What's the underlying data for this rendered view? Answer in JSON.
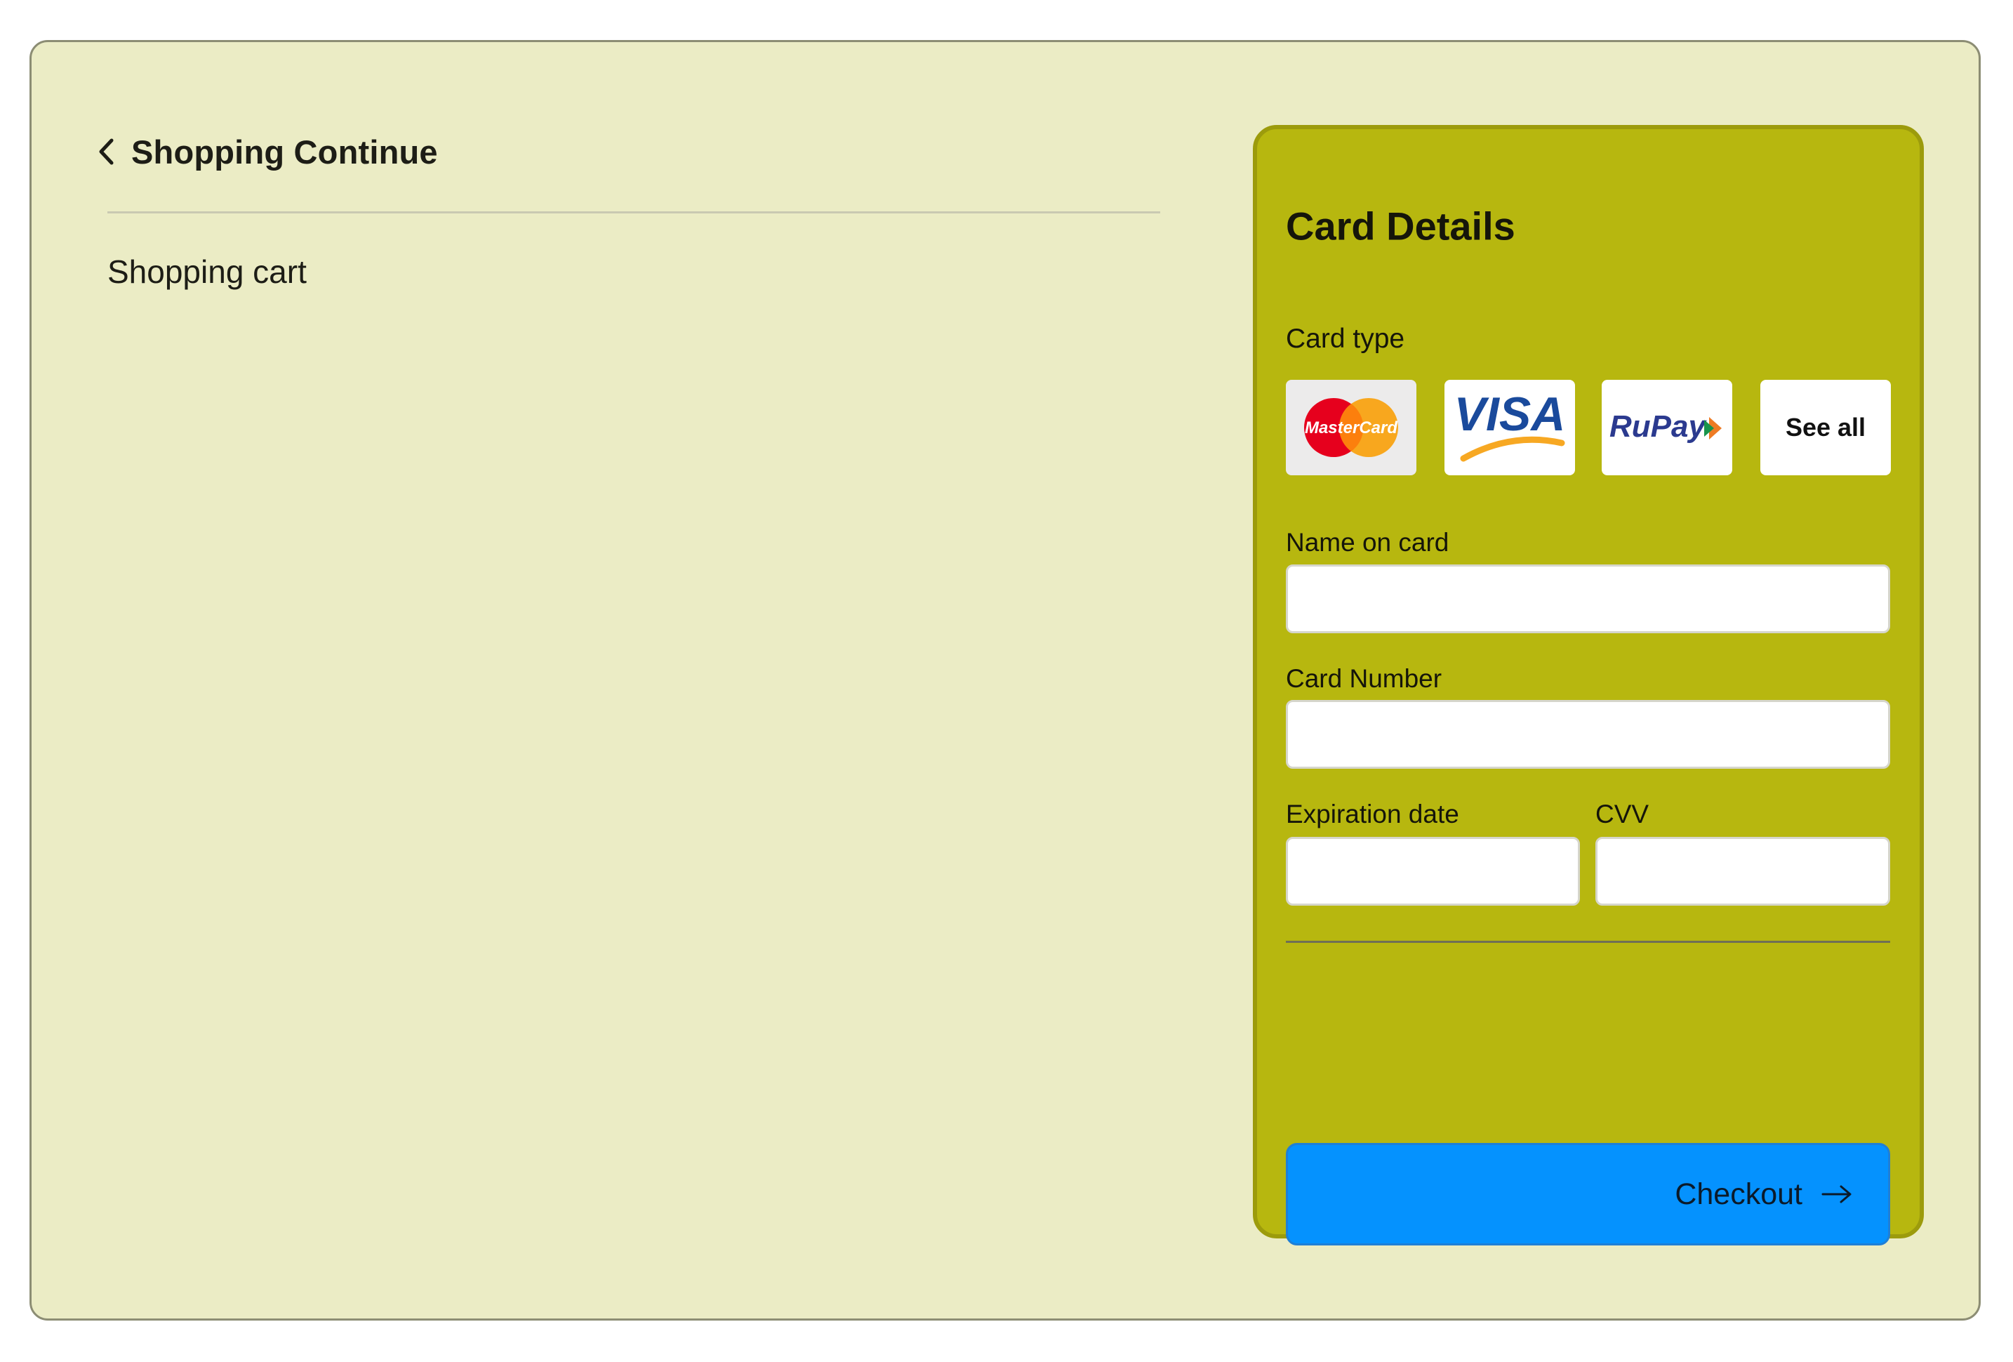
{
  "page": {
    "colors": {
      "background": "#ebecc5",
      "panel": "#b7b70f",
      "panel_border": "#9c9b0c",
      "accent_button": "#0592fe"
    }
  },
  "left": {
    "back_link_label": "Shopping Continue",
    "back_icon": "chevron-left-icon",
    "cart_title": "Shopping cart"
  },
  "card_details": {
    "title": "Card Details",
    "card_type_label": "Card type",
    "card_types": [
      {
        "name": "MasterCard",
        "logo_text": "MasterCard",
        "icon": "mastercard-logo"
      },
      {
        "name": "Visa",
        "logo_text": "VISA",
        "icon": "visa-logo"
      },
      {
        "name": "RuPay",
        "logo_text": "RuPay",
        "icon": "rupay-logo"
      }
    ],
    "see_all_label": "See all",
    "name_label": "Name on card",
    "name_value": "",
    "number_label": "Card Number",
    "number_value": "",
    "expiration_label": "Expiration date",
    "expiration_value": "",
    "cvv_label": "CVV",
    "cvv_value": "",
    "checkout_label": "Checkout",
    "checkout_icon": "arrow-right-icon"
  }
}
